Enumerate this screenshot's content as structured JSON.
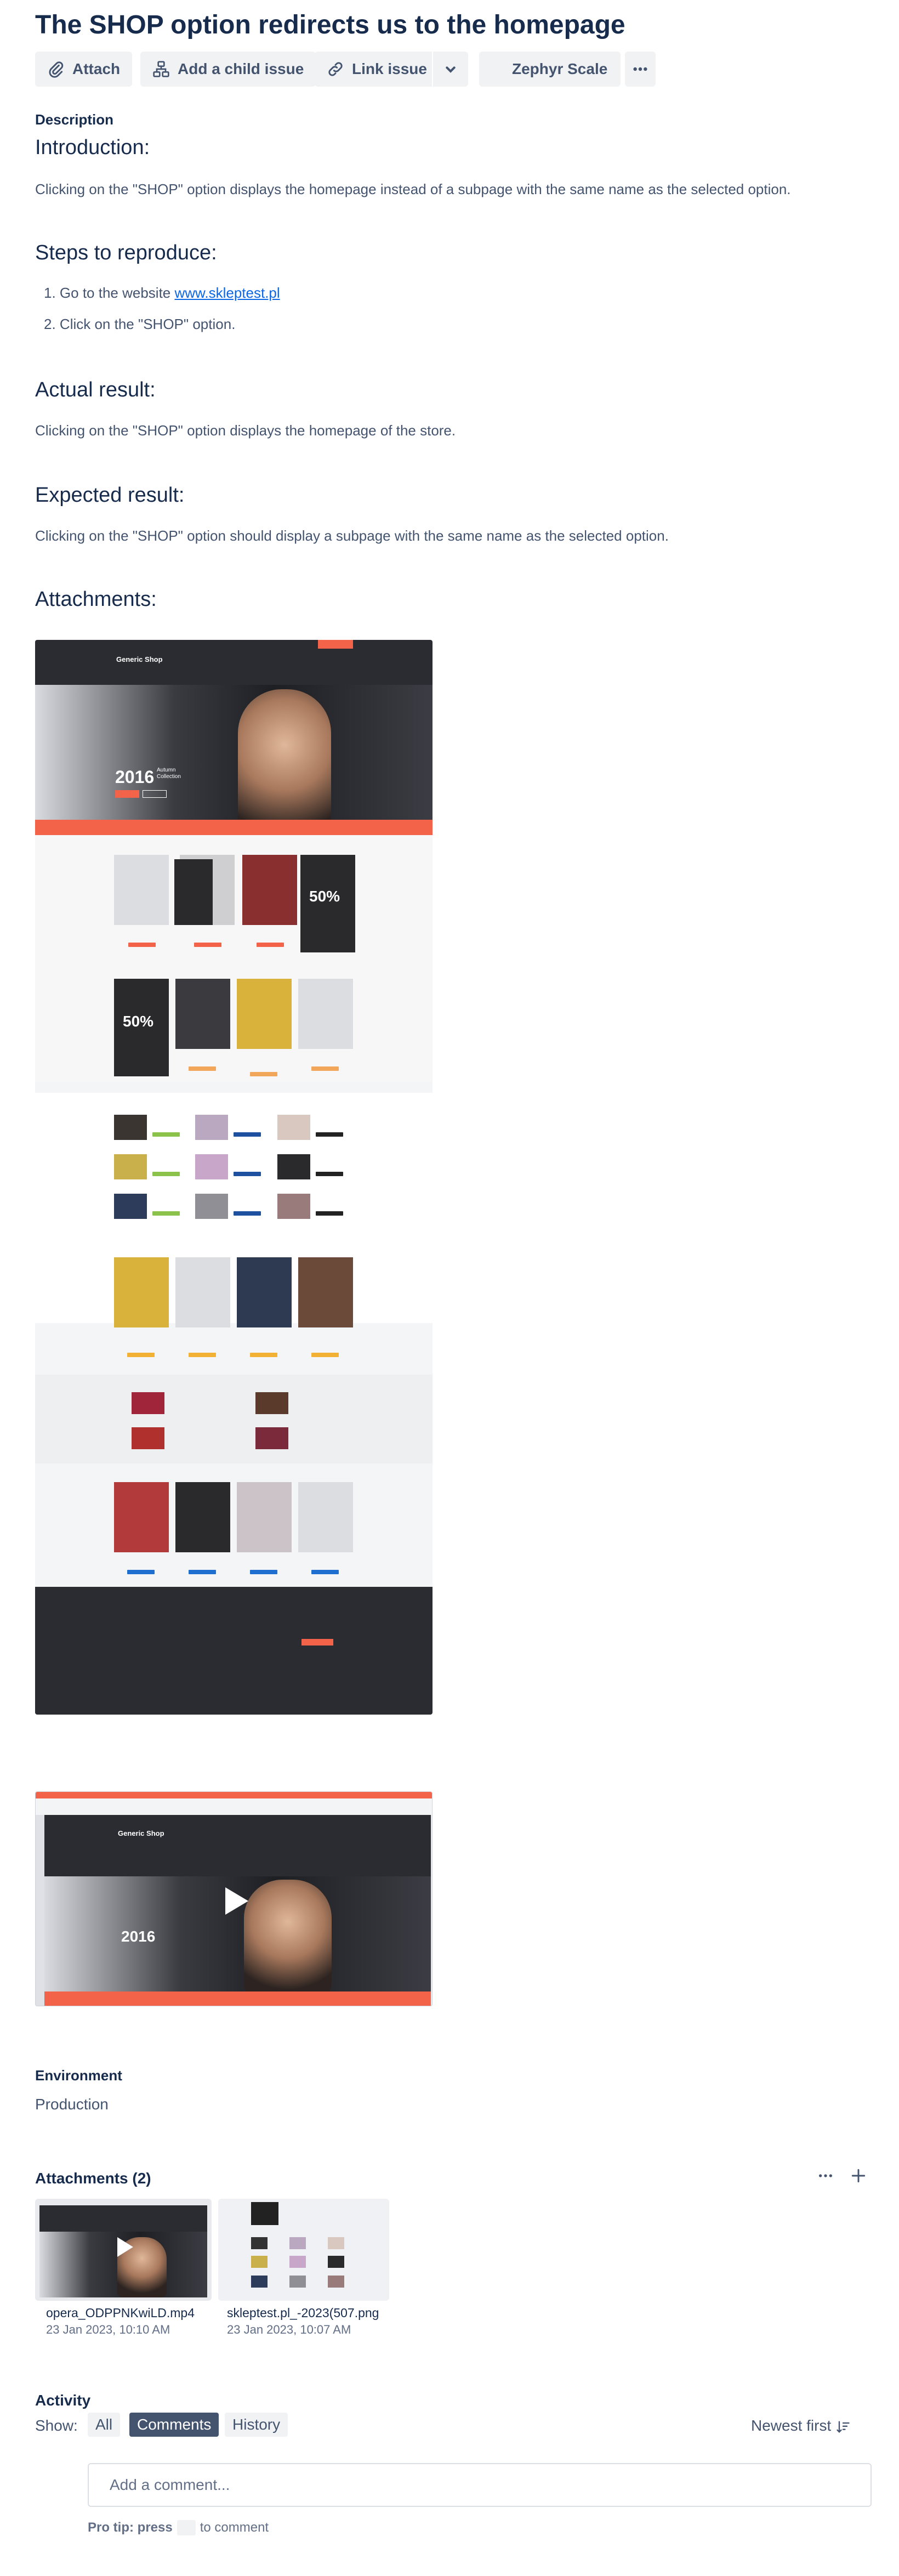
{
  "issue": {
    "title": "The SHOP option redirects us to the homepage"
  },
  "toolbar": {
    "attach": "Attach",
    "add_child": "Add a child issue",
    "link_issue": "Link issue",
    "zephyr": "Zephyr Scale"
  },
  "description": {
    "label": "Description",
    "intro_heading": "Introduction:",
    "intro_text": "Clicking on the \"SHOP\" option displays the homepage instead of a subpage with the same name as the selected option.",
    "steps_heading": "Steps to reproduce:",
    "step1_prefix": "Go to the website ",
    "step1_link": "www.skleptest.pl",
    "step2": "Click on the \"SHOP\" option.",
    "actual_heading": "Actual result:",
    "actual_text": "Clicking on the \"SHOP\" option displays the homepage of the store.",
    "expected_heading": "Expected result:",
    "expected_text": "Clicking on the \"SHOP\" option should display a subpage with the same name as the selected option.",
    "attachments_heading": "Attachments:"
  },
  "mock_site": {
    "shop_name": "Generic Shop",
    "hero_year": "2016",
    "hero_caption_1": "Autumn",
    "hero_caption_2": "Collection",
    "sale_big": "50%"
  },
  "environment": {
    "label": "Environment",
    "value": "Production"
  },
  "attachments": {
    "label": "Attachments (2)",
    "files": [
      {
        "name": "opera_ODPPNKwiLD.mp4",
        "date": "23 Jan 2023, 10:10 AM"
      },
      {
        "name": "skleptest.pl_-2023(507.png",
        "date": "23 Jan 2023, 10:07 AM"
      }
    ]
  },
  "activity": {
    "label": "Activity",
    "show_label": "Show:",
    "filters": [
      "All",
      "Comments",
      "History"
    ],
    "active_filter": "Comments",
    "sort_label": "Newest first",
    "comment_placeholder": "Add a comment...",
    "pro_tip_prefix": "Pro tip: press",
    "pro_tip_suffix": "to comment"
  },
  "colors": {
    "accent": "#f2634a",
    "text": "#172b4d",
    "link": "#0c66e4",
    "active_pill": "#44546f"
  }
}
